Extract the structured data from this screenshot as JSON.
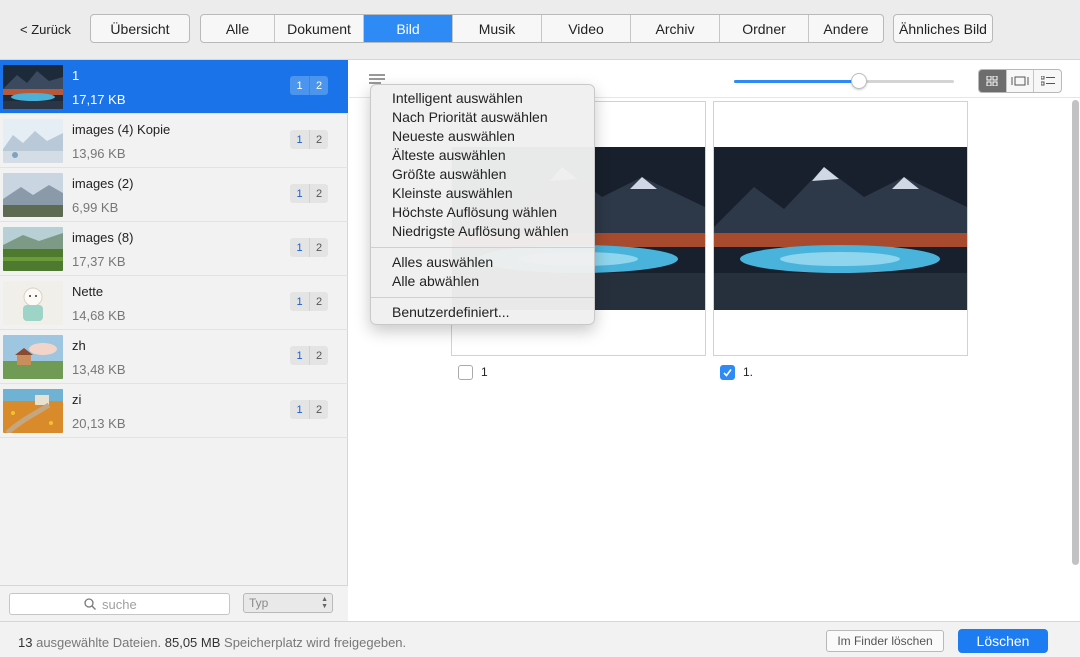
{
  "toolbar": {
    "back_label": "< Zurück",
    "overview_label": "Übersicht",
    "similar_label": "Ähnliches Bild",
    "tabs": [
      {
        "label": "Alle",
        "active": false
      },
      {
        "label": "Dokument",
        "active": false
      },
      {
        "label": "Bild",
        "active": true
      },
      {
        "label": "Musik",
        "active": false
      },
      {
        "label": "Video",
        "active": false
      },
      {
        "label": "Archiv",
        "active": false
      },
      {
        "label": "Ordner",
        "active": false
      },
      {
        "label": "Andere",
        "active": false
      }
    ]
  },
  "sidebar": {
    "files": [
      {
        "name": "1",
        "size": "17,17 KB",
        "badge1": "1",
        "badge2": "2",
        "selected": true
      },
      {
        "name": "images (4) Kopie",
        "size": "13,96 KB",
        "badge1": "1",
        "badge2": "2",
        "selected": false
      },
      {
        "name": "images (2)",
        "size": "6,99 KB",
        "badge1": "1",
        "badge2": "2",
        "selected": false
      },
      {
        "name": "images (8)",
        "size": "17,37 KB",
        "badge1": "1",
        "badge2": "2",
        "selected": false
      },
      {
        "name": "Nette",
        "size": "14,68 KB",
        "badge1": "1",
        "badge2": "2",
        "selected": false
      },
      {
        "name": "zh",
        "size": "13,48 KB",
        "badge1": "1",
        "badge2": "2",
        "selected": false
      },
      {
        "name": "zi",
        "size": "20,13 KB",
        "badge1": "1",
        "badge2": "2",
        "selected": false
      }
    ],
    "search_placeholder": "suche",
    "type_label": "Typ"
  },
  "main": {
    "zoom_level": 0.57,
    "view_mode": "grid",
    "cards": [
      {
        "label": "1",
        "checked": false
      },
      {
        "label": "1.",
        "checked": true
      }
    ]
  },
  "menu": {
    "group1": [
      "Intelligent auswählen",
      "Nach Priorität auswählen",
      "Neueste auswählen",
      "Älteste auswählen",
      "Größte auswählen",
      "Kleinste auswählen",
      "Höchste Auflösung wählen",
      "Niedrigste Auflösung wählen"
    ],
    "group2": [
      "Alles auswählen",
      "Alle abwählen"
    ],
    "group3": [
      "Benutzerdefiniert..."
    ]
  },
  "status": {
    "count": "13",
    "text1": "ausgewählte Dateien.",
    "size": "85,05 MB",
    "text2": "Speicherplatz wird freigegeben.",
    "finder_label": "Im Finder löschen",
    "delete_label": "Löschen"
  },
  "colors": {
    "accent": "#2e8bf6",
    "selected_row": "#1a73e8",
    "delete_button": "#1d7cf2"
  }
}
